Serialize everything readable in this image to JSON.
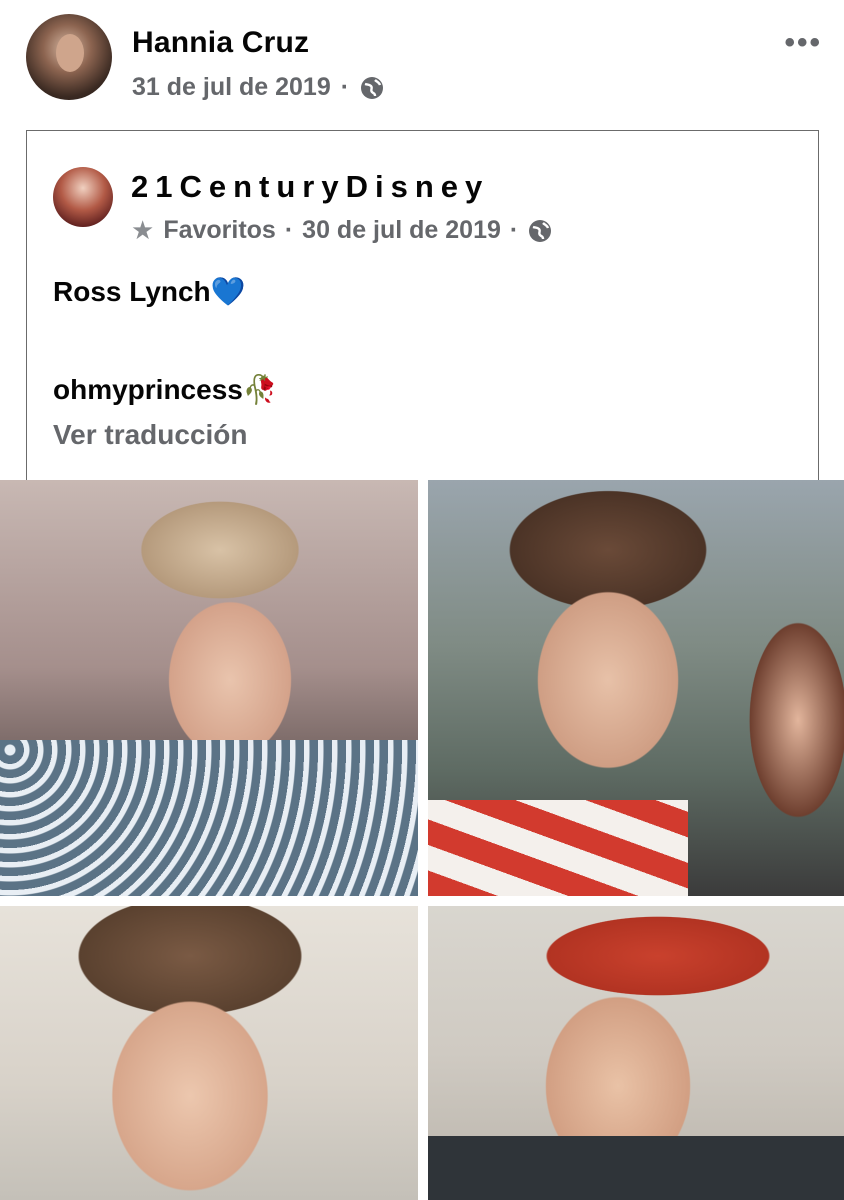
{
  "post": {
    "author_name": "Hannia Cruz",
    "date": "31 de jul de 2019",
    "separator": "·",
    "privacy_icon": "globe-icon",
    "more_icon": "more-horizontal-icon",
    "more_label": "•••"
  },
  "shared": {
    "author_name": "21CenturyDisney",
    "favorites_icon": "star-icon",
    "favorites_label": "Favoritos",
    "separator": "·",
    "date": "30 de jul de 2019",
    "privacy_icon": "globe-icon",
    "text_line1": "Ross Lynch💙",
    "text_line2": "ohmyprincess🥀",
    "translate_label": "Ver traducción"
  },
  "photos": [
    {
      "name": "photo-1"
    },
    {
      "name": "photo-2"
    },
    {
      "name": "photo-3"
    },
    {
      "name": "photo-4"
    }
  ],
  "colors": {
    "text_primary": "#050505",
    "text_secondary": "#65676b",
    "border": "#6b6b6b"
  }
}
